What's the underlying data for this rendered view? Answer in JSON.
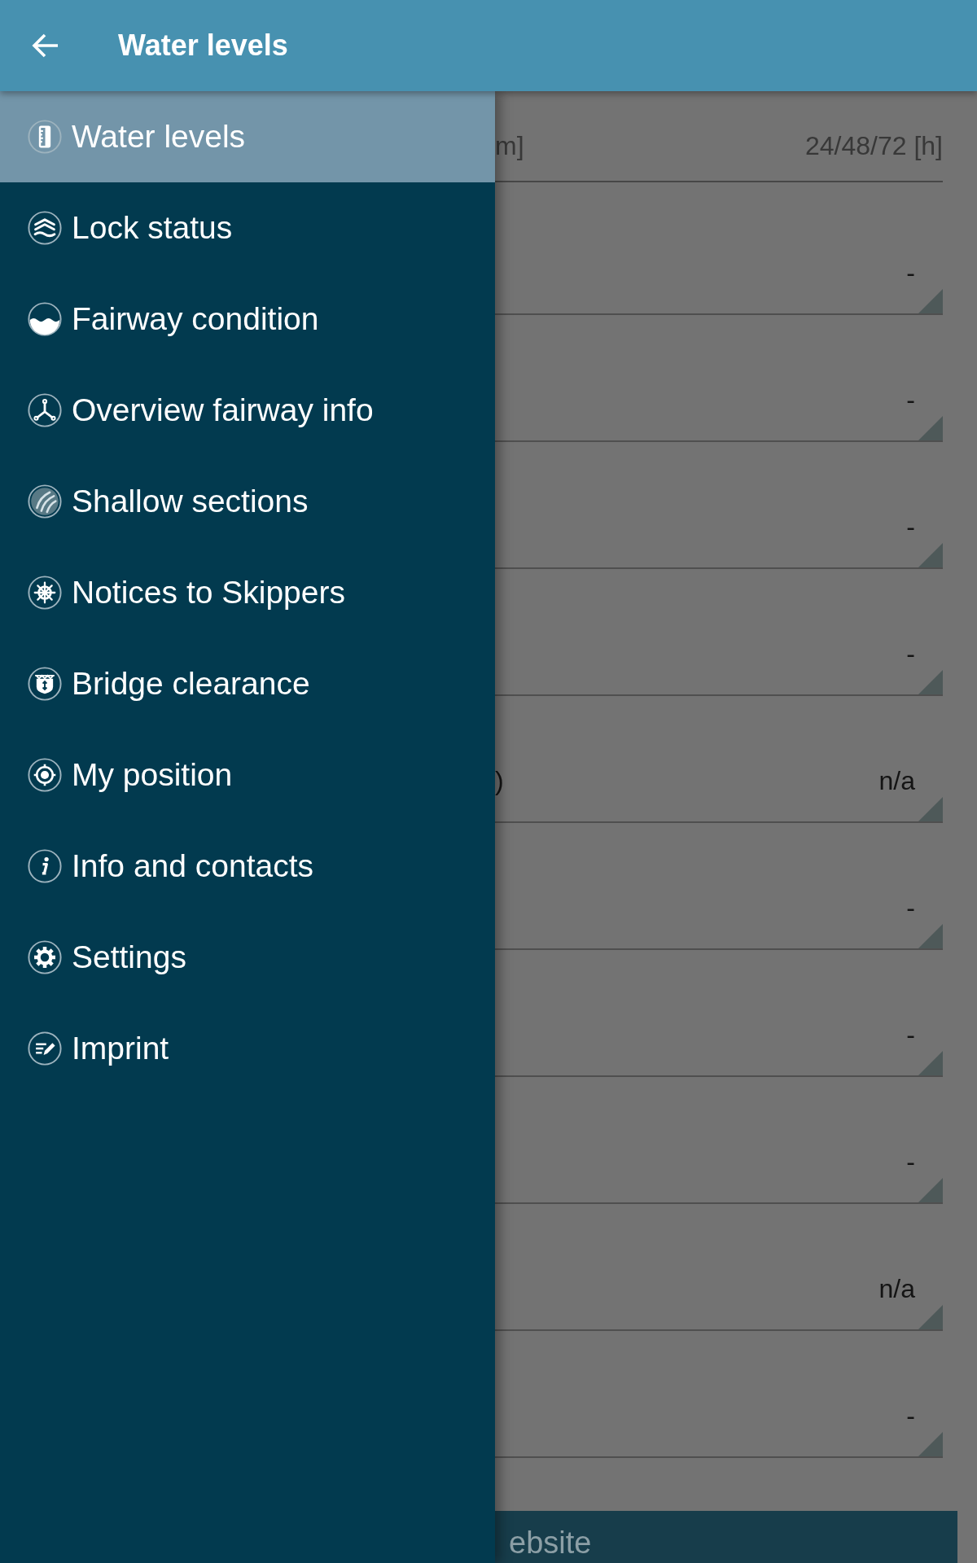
{
  "app_bar": {
    "title": "Water levels"
  },
  "drawer": {
    "items": [
      {
        "label": "Water levels",
        "selected": true
      },
      {
        "label": "Lock status",
        "selected": false
      },
      {
        "label": "Fairway condition",
        "selected": false
      },
      {
        "label": "Overview fairway info",
        "selected": false
      },
      {
        "label": "Shallow sections",
        "selected": false
      },
      {
        "label": "Notices to Skippers",
        "selected": false
      },
      {
        "label": "Bridge clearance",
        "selected": false
      },
      {
        "label": "My position",
        "selected": false
      },
      {
        "label": "Info and contacts",
        "selected": false
      },
      {
        "label": "Settings",
        "selected": false
      },
      {
        "label": "Imprint",
        "selected": false
      }
    ]
  },
  "content": {
    "columns": [
      "m]",
      "24/48/72 [h]"
    ],
    "rows": [
      {
        "value": "-"
      },
      {
        "value": "-"
      },
      {
        "value": "-"
      },
      {
        "value": "-"
      },
      {
        "label": ")",
        "value": "n/a"
      },
      {
        "value": "-"
      },
      {
        "value": "-"
      },
      {
        "value": "-"
      },
      {
        "value": "n/a"
      },
      {
        "value": "-"
      }
    ],
    "button": {
      "label": "ebsite"
    }
  }
}
